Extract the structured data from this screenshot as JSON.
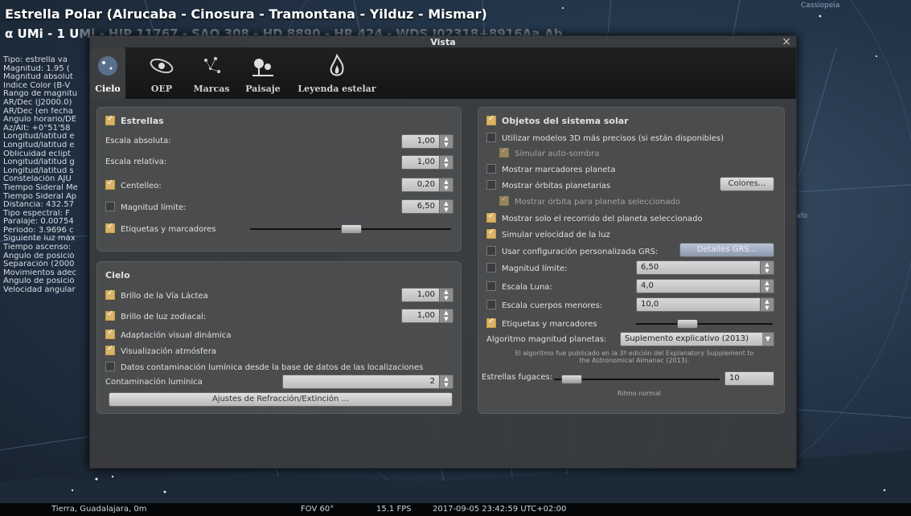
{
  "background": {
    "object_title": "Estrella Polar (Alrucaba - Cinosura - Tramontana - Yilduz - Mismar)",
    "object_subtitle_visible": "α UMi - 1 U",
    "object_subtitle_faded": "Mi - HIP 11767 - SAO 308 - HD 8890 - HR 424 - WDS J02318+8916Aa,Ab",
    "info_lines": [
      "Tipo: estrella va",
      "Magnitud: 1.95 (",
      "Magnitud absolut",
      "Indice Color (B-V",
      "Rango de magnitu",
      "AR/Dec (J2000.0)",
      "AR/Dec (en fecha",
      "Angulo horario/DE",
      "Az/Alt: +0°51'58",
      "Longitud/latitud e",
      "Longitud/latitud e",
      "Oblicuidad eclipt",
      "Longitud/latitud g",
      "Longitud/latitud s",
      "Constelación AJU",
      "Tiempo Sideral Me",
      "Tiempo Sideral Ap",
      "Distancia: 432.57",
      "Tipo espectral: F",
      "Paralaje: 0.00754",
      "Período: 3.9696 c",
      "Siguiente luz máx",
      "Tiempo ascenso:",
      "Angulo de posició",
      "Separación (2000",
      "Movimientos adec",
      "Angulo de posició",
      "Velocidad angular"
    ],
    "constellation_labels": [
      "Cassiopeia",
      "afo"
    ],
    "status_bar": {
      "location": "Tierra, Guadalajara, 0m",
      "fov": "FOV 60°",
      "fps": "15.1 FPS",
      "datetime": "2017-09-05 23:42:59 UTC+02:00"
    }
  },
  "dialog": {
    "title": "Vista",
    "close_glyph": "×",
    "tabs": [
      {
        "label": "Cielo",
        "icon": "sky-icon",
        "active": true
      },
      {
        "label": "OEP",
        "icon": "galaxy-icon",
        "active": false
      },
      {
        "label": "Marcas",
        "icon": "markings-icon",
        "active": false
      },
      {
        "label": "Paisaje",
        "icon": "landscape-icon",
        "active": false
      },
      {
        "label": "Leyenda estelar",
        "icon": "fire-icon",
        "active": false
      }
    ],
    "stars_panel": {
      "header": "Estrellas",
      "absolute_scale_label": "Escala absoluta:",
      "absolute_scale_value": "1,00",
      "relative_scale_label": "Escala relativa:",
      "relative_scale_value": "1,00",
      "twinkle_label": "Centelleo:",
      "twinkle_value": "0,20",
      "limit_magnitude_label": "Magnitud límite:",
      "limit_magnitude_value": "6,50",
      "labels_markers_label": "Etiquetas y marcadores",
      "labels_markers_slider": 0.5
    },
    "sky_panel": {
      "header": "Cielo",
      "milky_way_label": "Brillo de la Vía Láctea",
      "milky_way_value": "1,00",
      "zodiacal_label": "Brillo de luz zodiacal:",
      "zodiacal_value": "1,00",
      "adaptation_label": "Adaptación visual dinámica",
      "atmosphere_label": "Visualización atmósfera",
      "pollution_db_label": "Datos contaminación lumínica desde la base de datos de las localizaciones",
      "pollution_label": "Contaminación lumínica",
      "pollution_value": "2",
      "refraction_button": "Ajustes de Refracción/Extinción ..."
    },
    "solar_panel": {
      "header": "Objetos del sistema solar",
      "models3d_label": "Utilizar modelos 3D más precisos (si están disponibles)",
      "self_shadow_label": "Simular auto-sombra",
      "planet_markers_label": "Mostrar marcadores planeta",
      "planet_orbits_label": "Mostrar órbitas planetarias",
      "colors_button": "Colores...",
      "selected_orbit_label": "Mostrar órbita para planeta seleccionado",
      "selected_path_label": "Mostrar solo el recorrido del planeta seleccionado",
      "light_speed_label": "Simular velocidad de la luz",
      "grs_label": "Usar configuración personalizada GRS:",
      "grs_button": "Detalles GRS...",
      "limit_magnitude_label": "Magnitud límite:",
      "limit_magnitude_value": "6,50",
      "moon_scale_label": "Escala Luna:",
      "moon_scale_value": "4,0",
      "minor_scale_label": "Escala cuerpos menores:",
      "minor_scale_value": "10,0",
      "labels_markers_label": "Etiquetas y marcadores",
      "labels_markers_slider": 0.35,
      "algorithm_label": "Algoritmo magnitud planetas:",
      "algorithm_value": "Suplemento explicativo (2013)",
      "algorithm_note_1": "El algoritmo fue publicado en la 3ª edición del Explanatory Supplement to",
      "algorithm_note_2": "the Astronomical Almanac (2013).",
      "shooting_stars_label": "Estrellas fugaces:",
      "shooting_stars_value": "10",
      "shooting_stars_slider": 0.05,
      "shooting_stars_note": "Ritmo normal"
    }
  },
  "colors": {
    "accent_check": "#d8b46a",
    "dialog_bg": "#3a3c3e",
    "panel_bg": "#4a4c4e"
  }
}
